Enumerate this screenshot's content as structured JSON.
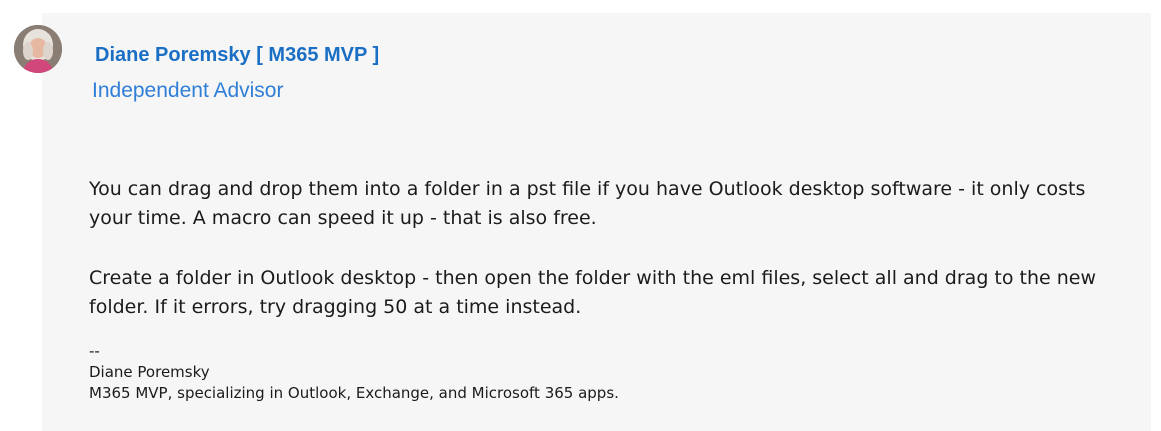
{
  "author": {
    "name": "Diane Poremsky [ M365 MVP ]",
    "title": "Independent Advisor",
    "avatar_icon": "user-avatar-photo"
  },
  "post": {
    "paragraph1": "You can drag and drop them into a folder in a pst file if you have Outlook desktop software - it only costs your time. A macro can speed it up - that is also free.",
    "paragraph2": "Create a folder in Outlook desktop - then open the folder with the eml files, select all and drag to the new folder. If it errors, try dragging 50 at a time instead."
  },
  "signature": {
    "separator": "--",
    "name": "Diane Poremsky",
    "tagline": "M365 MVP, specializing in Outlook, Exchange, and Microsoft 365 apps."
  },
  "colors": {
    "card_background": "#f6f6f6",
    "author_link": "#1a6fc4",
    "author_title": "#2f7ed8",
    "text": "#1b1b1b"
  }
}
